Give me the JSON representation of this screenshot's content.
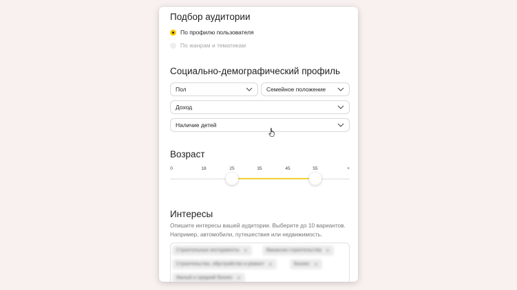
{
  "audience": {
    "title": "Подбор аудитории",
    "options": [
      {
        "label": "По профилю пользователя",
        "selected": true
      },
      {
        "label": "По жанрам и тематикам",
        "selected": false
      }
    ]
  },
  "demographics": {
    "title": "Социально-демографический профиль",
    "selects": {
      "gender": "Пол",
      "marital": "Семейное положение",
      "income": "Доход",
      "children": "Наличие детей"
    }
  },
  "age": {
    "title": "Возраст",
    "ticks": [
      "0",
      "18",
      "25",
      "35",
      "45",
      "55",
      "+"
    ],
    "min_value": "25",
    "max_value": "55"
  },
  "interests": {
    "title": "Интересы",
    "hint": "Опишите интересы вашей аудитории. Выберите до 10 вариантов. Например, автомобили, путешествия или недвижимость.",
    "tags": [
      "Строительные инструменты",
      "Вакансии строительства",
      "Строительство, обустройство и ремонт",
      "Бизнес",
      "Малый и средний бизнес"
    ]
  },
  "colors": {
    "accent": "#ffcc00",
    "slider_range": "#f2cf32",
    "background": "#f8f1ef"
  },
  "icons": [
    "chevron-down-icon",
    "hand-pointer-icon",
    "close-icon"
  ]
}
